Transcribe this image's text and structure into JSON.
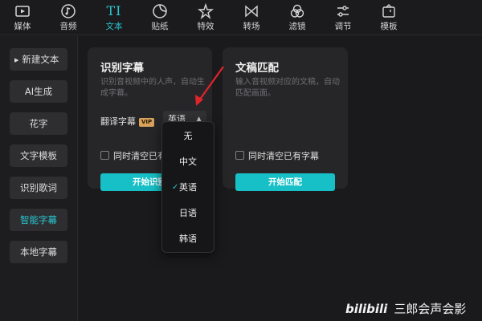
{
  "toolbar": {
    "items": [
      {
        "label": "媒体",
        "icon": "media-icon"
      },
      {
        "label": "音频",
        "icon": "music-note-icon"
      },
      {
        "label": "文本",
        "icon": "text-ti-icon"
      },
      {
        "label": "贴纸",
        "icon": "sticker-icon"
      },
      {
        "label": "特效",
        "icon": "sparkle-star-icon"
      },
      {
        "label": "转场",
        "icon": "bowtie-transition-icon"
      },
      {
        "label": "滤镜",
        "icon": "three-circles-filter-icon"
      },
      {
        "label": "调节",
        "icon": "sliders-adjust-icon"
      },
      {
        "label": "模板",
        "icon": "template-icon"
      }
    ],
    "active_index": 2,
    "text_icon_glyph": "TI"
  },
  "sidebar": {
    "items": [
      {
        "label": "新建文本"
      },
      {
        "label": "AI生成"
      },
      {
        "label": "花字"
      },
      {
        "label": "文字模板"
      },
      {
        "label": "识别歌词"
      },
      {
        "label": "智能字幕"
      },
      {
        "label": "本地字幕"
      }
    ],
    "active_index": 5
  },
  "recognize_card": {
    "title": "识别字幕",
    "desc": "识别音视频中的人声，自动生成字幕。",
    "translate_label": "翻译字幕",
    "vip_badge": "VIP",
    "selected_language": "英语",
    "checkbox_label": "同时清空已有字幕",
    "button_label": "开始识别"
  },
  "match_card": {
    "title": "文稿匹配",
    "desc": "输入音视频对应的文稿，自动匹配画面。",
    "checkbox_label": "同时清空已有字幕",
    "button_label": "开始匹配"
  },
  "language_dropdown": {
    "options": [
      "无",
      "中文",
      "英语",
      "日语",
      "韩语"
    ],
    "selected_index": 2
  },
  "watermark": {
    "logo": "bilibili",
    "text": "三郎会声会影"
  },
  "colors": {
    "accent": "#27c6cf",
    "button": "#17bfc6",
    "annotation_arrow": "#e0242a"
  }
}
